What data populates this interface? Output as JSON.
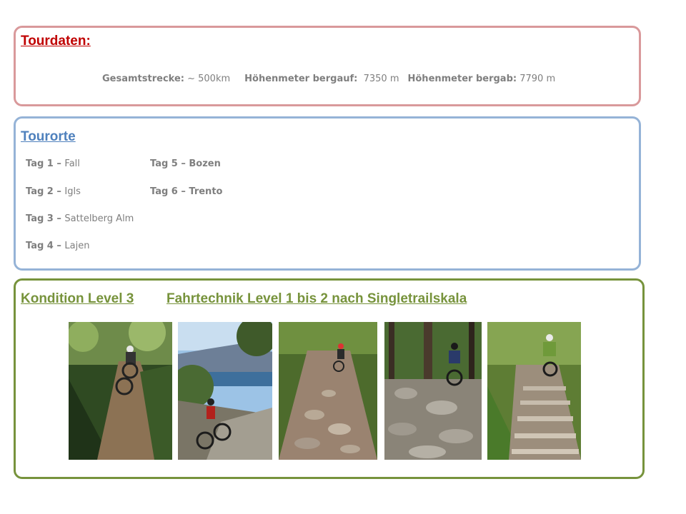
{
  "tourdaten": {
    "title": "Tourdaten:",
    "gesamtstrecke_label": "Gesamtstrecke:",
    "gesamtstrecke_value": " ~ 500km",
    "bergauf_label": "Höhenmeter bergauf:",
    "bergauf_value": "7350 m",
    "bergab_label": "Höhenmeter bergab:",
    "bergab_value": "7790 m"
  },
  "tourorte": {
    "title": "Tourorte",
    "days": [
      {
        "label": "Tag 1 – ",
        "place": "Fall"
      },
      {
        "label": "Tag 2 – ",
        "place": "Igls"
      },
      {
        "label": "Tag 3 – ",
        "place": "Sattelberg Alm"
      },
      {
        "label": "Tag 4 – ",
        "place": "Lajen"
      },
      {
        "label": "Tag 5 – Bozen",
        "place": ""
      },
      {
        "label": "Tag 6 – Trento",
        "place": ""
      }
    ]
  },
  "level": {
    "kondition": "Kondition Level 3",
    "fahrtechnik": "Fahrtechnik Level 1 bis 2 nach Singletrailskala"
  },
  "colors": {
    "tourdaten_border": "#d9999b",
    "tourdaten_heading": "#c00000",
    "tourorte_border": "#95b3d7",
    "tourorte_heading": "#4f81bd",
    "level_border": "#77933c",
    "body_text": "#7f7f7f"
  }
}
